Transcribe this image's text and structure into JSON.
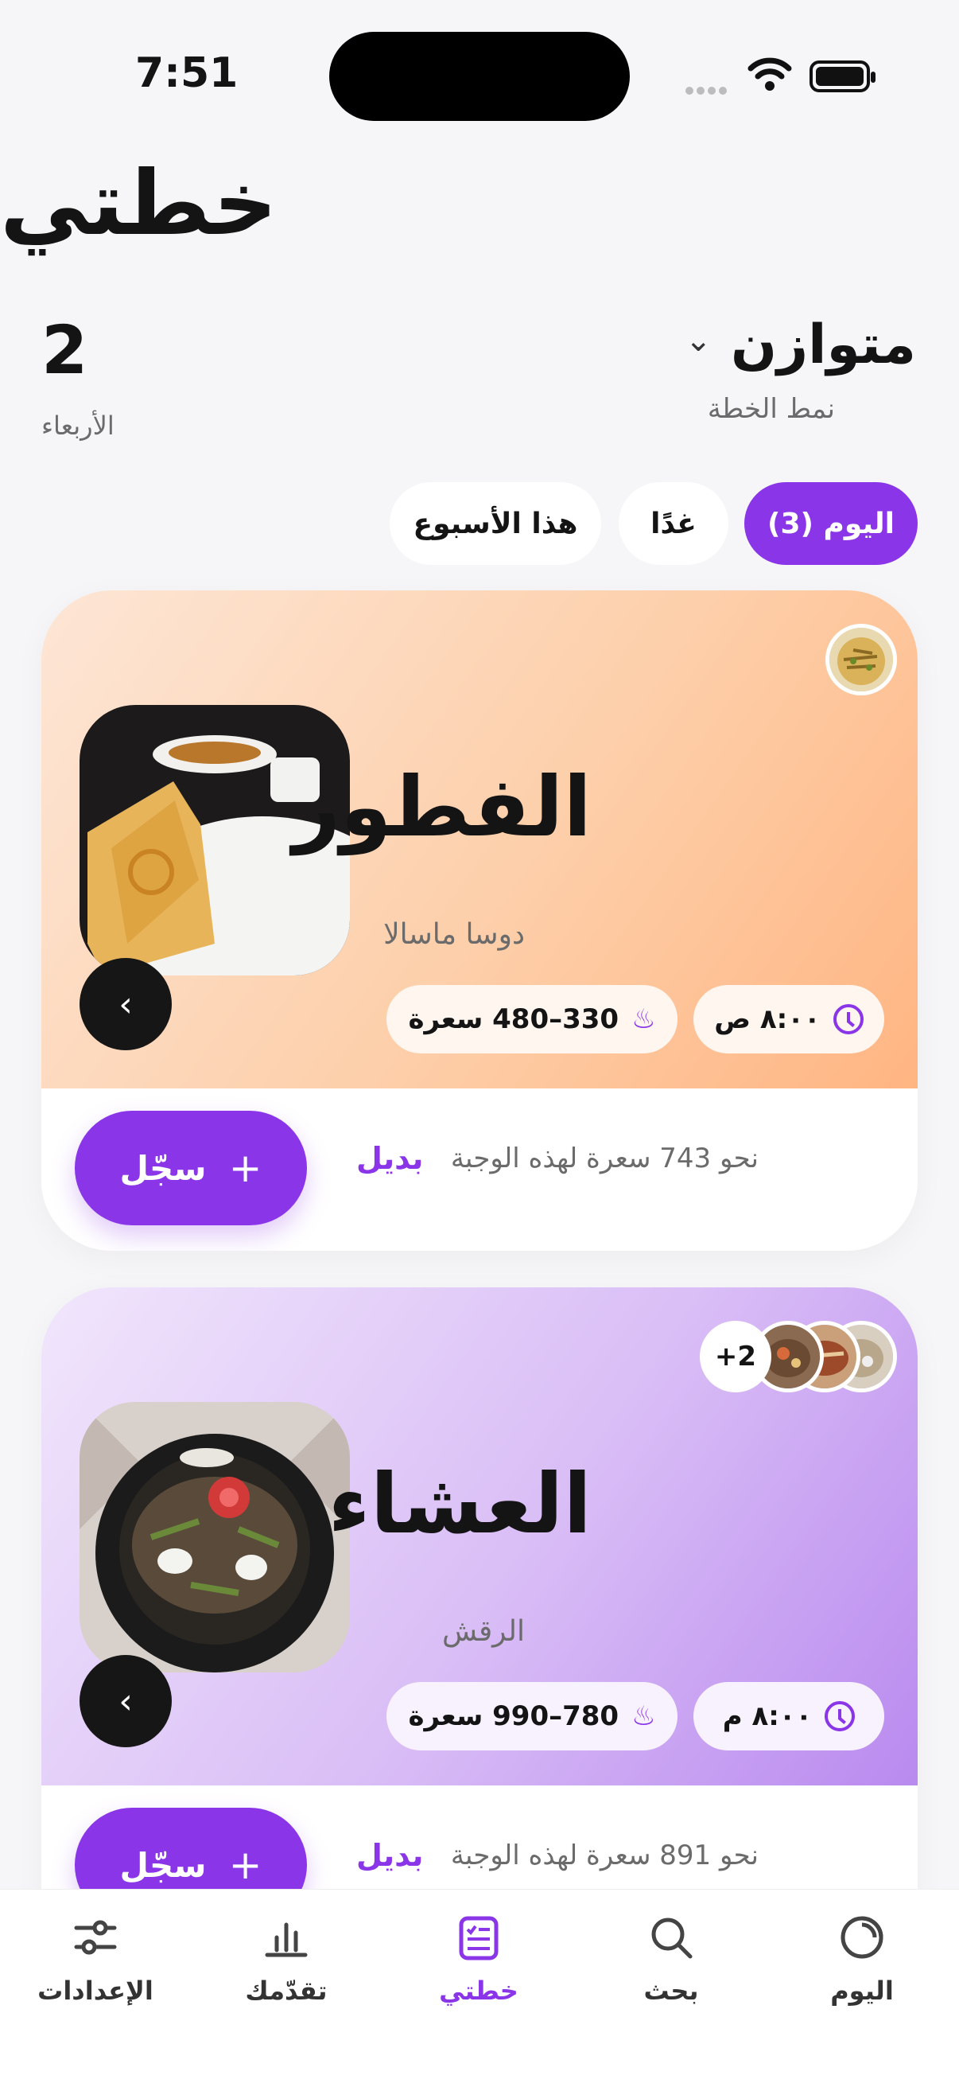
{
  "status_bar": {
    "time": "7:51"
  },
  "header": {
    "title": "خطتي",
    "week_number": "2",
    "week_label": "الأربعاء",
    "plan_mode": "متوازن",
    "plan_mode_label": "نمط الخطة"
  },
  "tabs": [
    {
      "label": "اليوم (3)",
      "active": true
    },
    {
      "label": "غدًا",
      "active": false
    },
    {
      "label": "هذا الأسبوع",
      "active": false
    }
  ],
  "meals": [
    {
      "name": "الفطور",
      "dish": "دوسا ماسالا",
      "time": "٨:٠٠ ص",
      "calories": "330–480 سعرة",
      "approx": "نحو 743 سعرة لهذه الوجبة",
      "alt_label": "بديل",
      "log_label": "سجّل",
      "extra_count": ""
    },
    {
      "name": "العشاء",
      "dish": "الرقش",
      "time": "٨:٠٠ م",
      "calories": "780–990 سعرة",
      "approx": "نحو 891 سعرة لهذه الوجبة",
      "alt_label": "بديل",
      "log_label": "سجّل",
      "extra_count": "+2"
    }
  ],
  "nav": {
    "today": "اليوم",
    "search": "بحث",
    "plan": "خطتي",
    "progress": "تقدّمك",
    "settings": "الإعدادات"
  },
  "colors": {
    "accent": "#8a35e8",
    "breakfast_bg": "#ffc49b",
    "dinner_bg": "#c8a3f4"
  }
}
